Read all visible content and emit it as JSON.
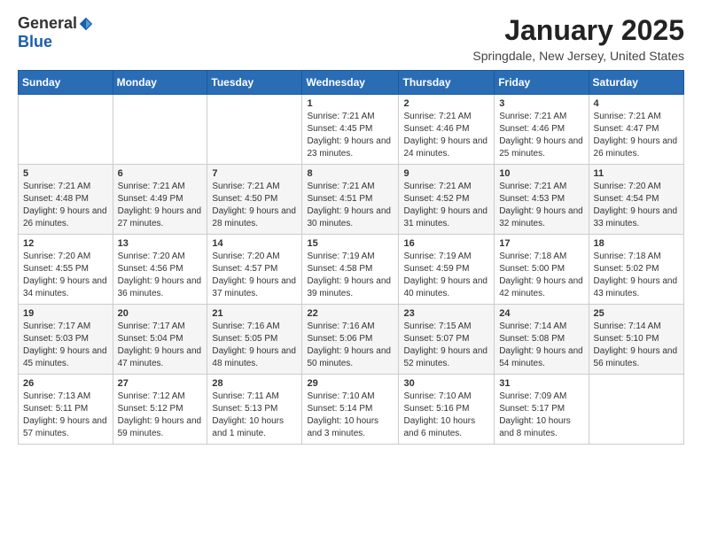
{
  "logo": {
    "general": "General",
    "blue": "Blue"
  },
  "title": "January 2025",
  "subtitle": "Springdale, New Jersey, United States",
  "headers": [
    "Sunday",
    "Monday",
    "Tuesday",
    "Wednesday",
    "Thursday",
    "Friday",
    "Saturday"
  ],
  "weeks": [
    [
      {
        "day": "",
        "info": ""
      },
      {
        "day": "",
        "info": ""
      },
      {
        "day": "",
        "info": ""
      },
      {
        "day": "1",
        "info": "Sunrise: 7:21 AM\nSunset: 4:45 PM\nDaylight: 9 hours\nand 23 minutes."
      },
      {
        "day": "2",
        "info": "Sunrise: 7:21 AM\nSunset: 4:46 PM\nDaylight: 9 hours\nand 24 minutes."
      },
      {
        "day": "3",
        "info": "Sunrise: 7:21 AM\nSunset: 4:46 PM\nDaylight: 9 hours\nand 25 minutes."
      },
      {
        "day": "4",
        "info": "Sunrise: 7:21 AM\nSunset: 4:47 PM\nDaylight: 9 hours\nand 26 minutes."
      }
    ],
    [
      {
        "day": "5",
        "info": "Sunrise: 7:21 AM\nSunset: 4:48 PM\nDaylight: 9 hours\nand 26 minutes."
      },
      {
        "day": "6",
        "info": "Sunrise: 7:21 AM\nSunset: 4:49 PM\nDaylight: 9 hours\nand 27 minutes."
      },
      {
        "day": "7",
        "info": "Sunrise: 7:21 AM\nSunset: 4:50 PM\nDaylight: 9 hours\nand 28 minutes."
      },
      {
        "day": "8",
        "info": "Sunrise: 7:21 AM\nSunset: 4:51 PM\nDaylight: 9 hours\nand 30 minutes."
      },
      {
        "day": "9",
        "info": "Sunrise: 7:21 AM\nSunset: 4:52 PM\nDaylight: 9 hours\nand 31 minutes."
      },
      {
        "day": "10",
        "info": "Sunrise: 7:21 AM\nSunset: 4:53 PM\nDaylight: 9 hours\nand 32 minutes."
      },
      {
        "day": "11",
        "info": "Sunrise: 7:20 AM\nSunset: 4:54 PM\nDaylight: 9 hours\nand 33 minutes."
      }
    ],
    [
      {
        "day": "12",
        "info": "Sunrise: 7:20 AM\nSunset: 4:55 PM\nDaylight: 9 hours\nand 34 minutes."
      },
      {
        "day": "13",
        "info": "Sunrise: 7:20 AM\nSunset: 4:56 PM\nDaylight: 9 hours\nand 36 minutes."
      },
      {
        "day": "14",
        "info": "Sunrise: 7:20 AM\nSunset: 4:57 PM\nDaylight: 9 hours\nand 37 minutes."
      },
      {
        "day": "15",
        "info": "Sunrise: 7:19 AM\nSunset: 4:58 PM\nDaylight: 9 hours\nand 39 minutes."
      },
      {
        "day": "16",
        "info": "Sunrise: 7:19 AM\nSunset: 4:59 PM\nDaylight: 9 hours\nand 40 minutes."
      },
      {
        "day": "17",
        "info": "Sunrise: 7:18 AM\nSunset: 5:00 PM\nDaylight: 9 hours\nand 42 minutes."
      },
      {
        "day": "18",
        "info": "Sunrise: 7:18 AM\nSunset: 5:02 PM\nDaylight: 9 hours\nand 43 minutes."
      }
    ],
    [
      {
        "day": "19",
        "info": "Sunrise: 7:17 AM\nSunset: 5:03 PM\nDaylight: 9 hours\nand 45 minutes."
      },
      {
        "day": "20",
        "info": "Sunrise: 7:17 AM\nSunset: 5:04 PM\nDaylight: 9 hours\nand 47 minutes."
      },
      {
        "day": "21",
        "info": "Sunrise: 7:16 AM\nSunset: 5:05 PM\nDaylight: 9 hours\nand 48 minutes."
      },
      {
        "day": "22",
        "info": "Sunrise: 7:16 AM\nSunset: 5:06 PM\nDaylight: 9 hours\nand 50 minutes."
      },
      {
        "day": "23",
        "info": "Sunrise: 7:15 AM\nSunset: 5:07 PM\nDaylight: 9 hours\nand 52 minutes."
      },
      {
        "day": "24",
        "info": "Sunrise: 7:14 AM\nSunset: 5:08 PM\nDaylight: 9 hours\nand 54 minutes."
      },
      {
        "day": "25",
        "info": "Sunrise: 7:14 AM\nSunset: 5:10 PM\nDaylight: 9 hours\nand 56 minutes."
      }
    ],
    [
      {
        "day": "26",
        "info": "Sunrise: 7:13 AM\nSunset: 5:11 PM\nDaylight: 9 hours\nand 57 minutes."
      },
      {
        "day": "27",
        "info": "Sunrise: 7:12 AM\nSunset: 5:12 PM\nDaylight: 9 hours\nand 59 minutes."
      },
      {
        "day": "28",
        "info": "Sunrise: 7:11 AM\nSunset: 5:13 PM\nDaylight: 10 hours\nand 1 minute."
      },
      {
        "day": "29",
        "info": "Sunrise: 7:10 AM\nSunset: 5:14 PM\nDaylight: 10 hours\nand 3 minutes."
      },
      {
        "day": "30",
        "info": "Sunrise: 7:10 AM\nSunset: 5:16 PM\nDaylight: 10 hours\nand 6 minutes."
      },
      {
        "day": "31",
        "info": "Sunrise: 7:09 AM\nSunset: 5:17 PM\nDaylight: 10 hours\nand 8 minutes."
      },
      {
        "day": "",
        "info": ""
      }
    ]
  ]
}
